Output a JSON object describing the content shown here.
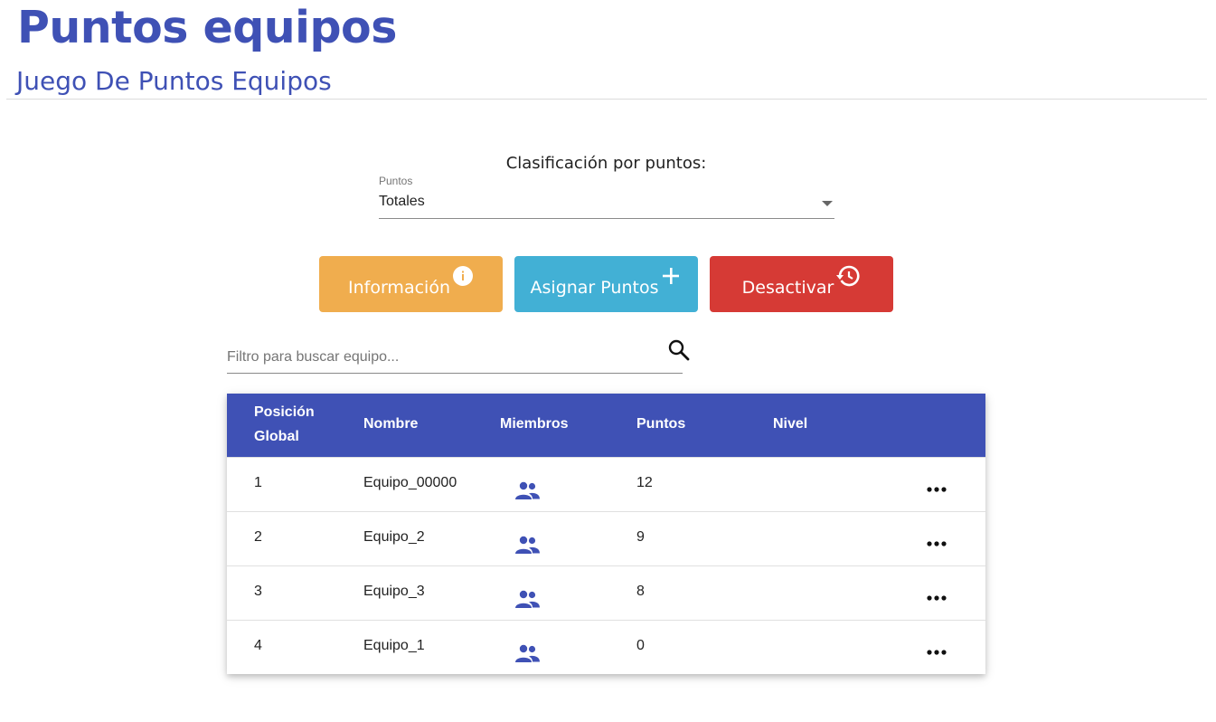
{
  "header": {
    "title": "Puntos equipos",
    "subtitle": "Juego De Puntos Equipos"
  },
  "ranking": {
    "label": "Clasificación por puntos:",
    "select_label": "Puntos",
    "select_value": "Totales"
  },
  "actions": {
    "info_label": "Información",
    "assign_label": "Asignar Puntos",
    "deactivate_label": "Desactivar"
  },
  "search": {
    "placeholder": "Filtro para buscar equipo..."
  },
  "table": {
    "headers": {
      "position_line1": "Posición",
      "position_line2": "Global",
      "name": "Nombre",
      "members": "Miembros",
      "points": "Puntos",
      "level": "Nivel"
    },
    "rows": [
      {
        "position": "1",
        "name": "Equipo_00000",
        "points": "12"
      },
      {
        "position": "2",
        "name": "Equipo_2",
        "points": "9"
      },
      {
        "position": "3",
        "name": "Equipo_3",
        "points": "8"
      },
      {
        "position": "4",
        "name": "Equipo_1",
        "points": "0"
      }
    ]
  },
  "colors": {
    "primary": "#3f51b5",
    "warning": "#f0ad4e",
    "info": "#42b0d5",
    "danger": "#d63a35"
  },
  "icons": {
    "info": "info-circle-icon",
    "add": "plus-icon",
    "deactivate": "history-icon",
    "search": "search-icon",
    "members": "group-icon",
    "more": "more-horiz-icon"
  }
}
